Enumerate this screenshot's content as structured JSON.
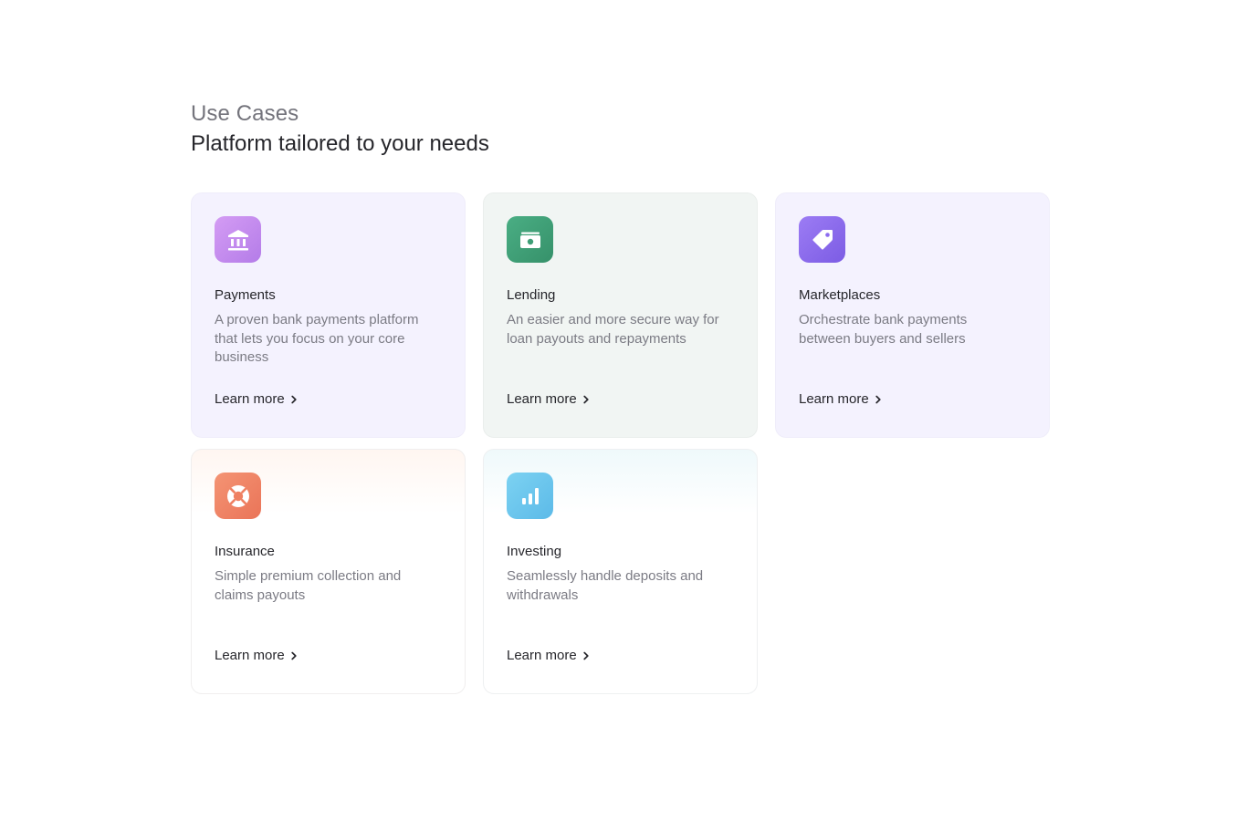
{
  "section": {
    "eyebrow": "Use Cases",
    "heading": "Platform tailored to your needs"
  },
  "cards": [
    {
      "title": "Payments",
      "description": "A proven bank payments platform that lets you focus on your core business",
      "link": "Learn more",
      "icon": "bank-icon",
      "color": "#c48cf0"
    },
    {
      "title": "Lending",
      "description": "An easier and more secure way for loan payouts and repayments",
      "link": "Learn more",
      "icon": "cash-icon",
      "color": "#3e9e76"
    },
    {
      "title": "Marketplaces",
      "description": "Orchestrate bank payments between buyers and sellers",
      "link": "Learn more",
      "icon": "tag-icon",
      "color": "#8c6cf0"
    },
    {
      "title": "Insurance",
      "description": "Simple premium collection and claims payouts",
      "link": "Learn more",
      "icon": "lifebuoy-icon",
      "color": "#f08466"
    },
    {
      "title": "Investing",
      "description": "Seamlessly handle deposits and withdrawals",
      "link": "Learn more",
      "icon": "bar-chart-icon",
      "color": "#6cc8ee"
    }
  ]
}
